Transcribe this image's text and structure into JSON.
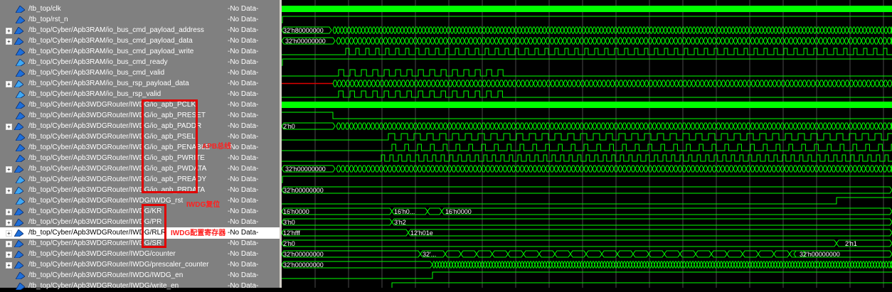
{
  "signals": [
    {
      "name": "/tb_top/clk",
      "value": "-No Data-",
      "expandable": false,
      "kind": "in"
    },
    {
      "name": "/tb_top/rst_n",
      "value": "-No Data-",
      "expandable": false,
      "kind": "in"
    },
    {
      "name": "/tb_top/Cyber/Apb3RAM/io_bus_cmd_payload_address",
      "value": "-No Data-",
      "expandable": true,
      "kind": "in"
    },
    {
      "name": "/tb_top/Cyber/Apb3RAM/io_bus_cmd_payload_data",
      "value": "-No Data-",
      "expandable": true,
      "kind": "in"
    },
    {
      "name": "/tb_top/Cyber/Apb3RAM/io_bus_cmd_payload_write",
      "value": "-No Data-",
      "expandable": false,
      "kind": "in"
    },
    {
      "name": "/tb_top/Cyber/Apb3RAM/io_bus_cmd_ready",
      "value": "-No Data-",
      "expandable": false,
      "kind": "out"
    },
    {
      "name": "/tb_top/Cyber/Apb3RAM/io_bus_cmd_valid",
      "value": "-No Data-",
      "expandable": false,
      "kind": "in"
    },
    {
      "name": "/tb_top/Cyber/Apb3RAM/io_bus_rsp_payload_data",
      "value": "-No Data-",
      "expandable": true,
      "kind": "out"
    },
    {
      "name": "/tb_top/Cyber/Apb3RAM/io_bus_rsp_valid",
      "value": "-No Data-",
      "expandable": false,
      "kind": "out"
    },
    {
      "name": "/tb_top/Cyber/Apb3WDGRouter/IWDG/io_apb_PCLK",
      "value": "-No Data-",
      "expandable": false,
      "kind": "in"
    },
    {
      "name": "/tb_top/Cyber/Apb3WDGRouter/IWDG/io_apb_PRESET",
      "value": "-No Data-",
      "expandable": false,
      "kind": "in"
    },
    {
      "name": "/tb_top/Cyber/Apb3WDGRouter/IWDG/io_apb_PADDR",
      "value": "-No Data-",
      "expandable": true,
      "kind": "in"
    },
    {
      "name": "/tb_top/Cyber/Apb3WDGRouter/IWDG/io_apb_PSEL",
      "value": "-No Data-",
      "expandable": false,
      "kind": "in"
    },
    {
      "name": "/tb_top/Cyber/Apb3WDGRouter/IWDG/io_apb_PENABLE",
      "value": "-No Data-",
      "expandable": false,
      "kind": "in"
    },
    {
      "name": "/tb_top/Cyber/Apb3WDGRouter/IWDG/io_apb_PWRITE",
      "value": "-No Data-",
      "expandable": false,
      "kind": "in"
    },
    {
      "name": "/tb_top/Cyber/Apb3WDGRouter/IWDG/io_apb_PWDATA",
      "value": "-No Data-",
      "expandable": true,
      "kind": "in"
    },
    {
      "name": "/tb_top/Cyber/Apb3WDGRouter/IWDG/io_apb_PREADY",
      "value": "-No Data-",
      "expandable": false,
      "kind": "out"
    },
    {
      "name": "/tb_top/Cyber/Apb3WDGRouter/IWDG/io_apb_PRDATA",
      "value": "-No Data-",
      "expandable": true,
      "kind": "out"
    },
    {
      "name": "/tb_top/Cyber/Apb3WDGRouter/IWDG/IWDG_rst",
      "value": "-No Data-",
      "expandable": false,
      "kind": "out"
    },
    {
      "name": "/tb_top/Cyber/Apb3WDGRouter/IWDG/KR",
      "value": "-No Data-",
      "expandable": true,
      "kind": "in"
    },
    {
      "name": "/tb_top/Cyber/Apb3WDGRouter/IWDG/PR",
      "value": "-No Data-",
      "expandable": true,
      "kind": "in"
    },
    {
      "name": "/tb_top/Cyber/Apb3WDGRouter/IWDG/RLR",
      "value": "-No Data-",
      "expandable": true,
      "kind": "in"
    },
    {
      "name": "/tb_top/Cyber/Apb3WDGRouter/IWDG/SR",
      "value": "-No Data-",
      "expandable": true,
      "kind": "in"
    },
    {
      "name": "/tb_top/Cyber/Apb3WDGRouter/IWDG/counter",
      "value": "-No Data-",
      "expandable": true,
      "kind": "in"
    },
    {
      "name": "/tb_top/Cyber/Apb3WDGRouter/IWDG/prescaler_counter",
      "value": "-No Data-",
      "expandable": true,
      "kind": "in"
    },
    {
      "name": "/tb_top/Cyber/Apb3WDGRouter/IWDG/IWDG_en",
      "value": "-No Data-",
      "expandable": false,
      "kind": "in"
    },
    {
      "name": "/tb_top/Cyber/Apb3WDGRouter/IWDG/write_en",
      "value": "-No Data-",
      "expandable": false,
      "kind": "in"
    }
  ],
  "annotations": {
    "apb_label": "APB总线",
    "rst_label": "IWDG复位",
    "cfg_label": "IWDG配置寄存器"
  },
  "wave_labels": {
    "addr_init": "32'h80000000",
    "data_init": "32'h00000000",
    "paddr_init": "2'h0",
    "pwdata_init": "32'h00000000",
    "prdata_init": "32'h00000000",
    "kr_init": "16'h0000",
    "kr_mid": "16'h0...",
    "kr_end": "16'h0000",
    "pr_init": "3'h0",
    "pr_end": "3'h2",
    "rlr_init": "12'hfff",
    "rlr_end": "12'h01e",
    "sr_init": "2'h0",
    "sr_end": "2'h1",
    "counter_init": "32'h00000000",
    "counter_mid": "32'...",
    "counter_end": "32'h00000000",
    "presc_init": "32'h00000000"
  },
  "colors": {
    "wave": "#00ff00",
    "rst_bus": "#e00000",
    "grid": "#4a4a4a",
    "selected_row": "#ffffff",
    "annotation": "#e00000"
  },
  "selected_index": 21
}
